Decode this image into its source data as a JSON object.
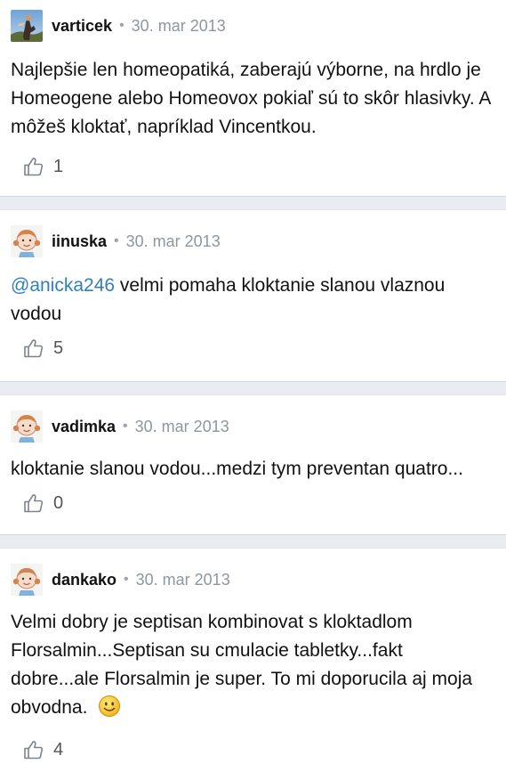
{
  "comments": [
    {
      "author": "varticek",
      "date": "30. mar 2013",
      "mention": "",
      "text": "Najlepšie len homeopatiká, zaberajú výborne, na hrdlo je Homeogene alebo Homeovox pokiaľ sú to skôr hlasivky. A môžeš kloktať, napríklad Vincentkou.",
      "likes": "1",
      "avatar": "photo-avatar-icon"
    },
    {
      "author": "iinuska",
      "date": "30. mar 2013",
      "mention": "@anicka246",
      "text": "velmi pomaha kloktanie slanou vlaznou vodou",
      "likes": "5",
      "avatar": "girl-avatar-icon"
    },
    {
      "author": "vadimka",
      "date": "30. mar 2013",
      "mention": "",
      "text": "kloktanie slanou vodou...medzi tym preventan quatro...",
      "likes": "0",
      "avatar": "girl-avatar-icon"
    },
    {
      "author": "dankako",
      "date": "30. mar 2013",
      "mention": "",
      "text": "Velmi dobry je septisan kombinovat s kloktadlom Florsalmin...Septisan su cmulacie tabletky...fakt dobre...ale Florsalmin je super. To mi doporucila aj moja obvodna.",
      "likes": "4",
      "avatar": "girl-avatar-icon",
      "emoji": "smiley-emoji-icon"
    }
  ],
  "colors": {
    "mention": "#2f7fbf",
    "separator": "#e9edf1",
    "meta": "#8e969e"
  },
  "icons": {
    "like": "thumbs-up-icon"
  }
}
